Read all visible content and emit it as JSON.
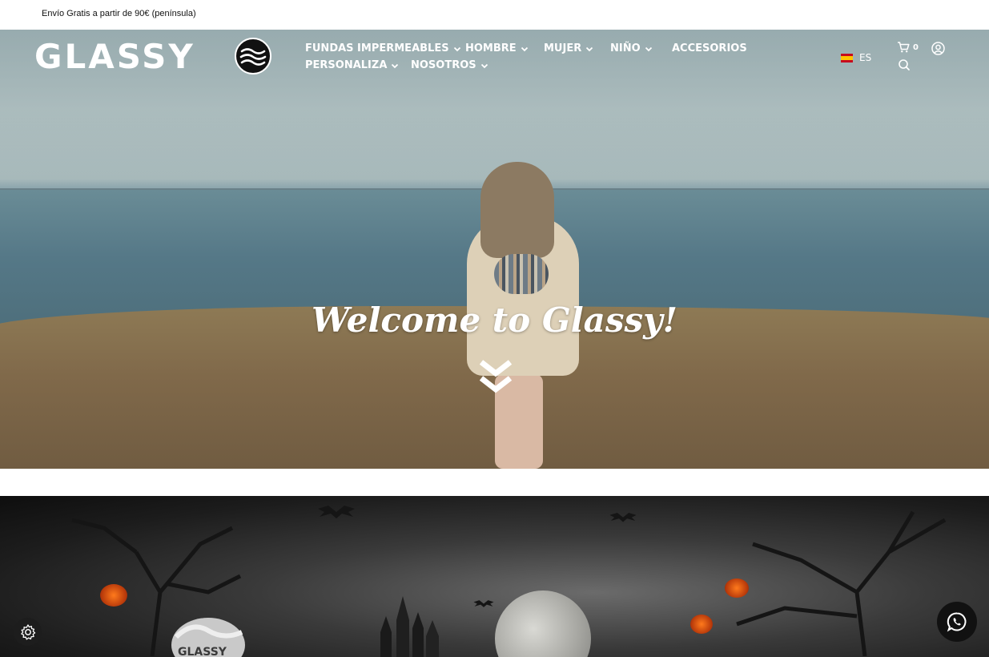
{
  "topbar": {
    "shipping_text": "Envío Gratis a partir de 90€ (península)"
  },
  "header": {
    "logo_text": "GLASSY",
    "nav": {
      "fundas": "FUNDAS IMPERMEABLES",
      "hombre": "HOMBRE",
      "mujer": "MUJER",
      "nino": "NIÑO",
      "accesorios": "ACCESORIOS",
      "personaliza": "PERSONALIZA",
      "nosotros": "NOSOTROS"
    },
    "language": "ES",
    "cart_count": "0"
  },
  "hero": {
    "welcome_text": "Welcome to Glassy!"
  },
  "banner": {
    "logo_text": "GLASSY"
  },
  "colors": {
    "header_text": "#ffffff",
    "floating_button_bg": "#111111"
  }
}
